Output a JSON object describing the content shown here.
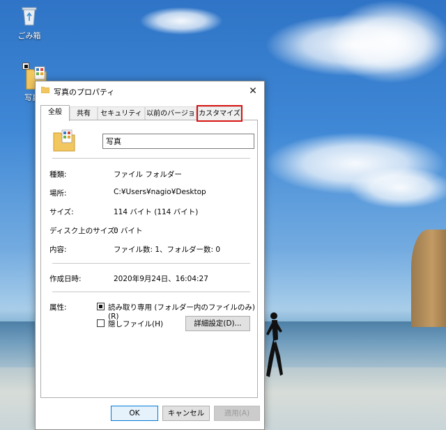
{
  "desktop": {
    "icons": [
      {
        "label": "ごみ箱",
        "icon": "recycle-bin-icon"
      },
      {
        "label": "写真",
        "icon": "folder-icon"
      }
    ]
  },
  "dialog": {
    "title": "写真のプロパティ",
    "close_glyph": "✕",
    "tabs": [
      {
        "label": "全般",
        "active": true
      },
      {
        "label": "共有"
      },
      {
        "label": "セキュリティ"
      },
      {
        "label": "以前のバージョン"
      },
      {
        "label": "カスタマイズ",
        "highlighted": true
      }
    ],
    "name_value": "写真",
    "rows": {
      "type": {
        "label": "種類:",
        "value": "ファイル フォルダー"
      },
      "location": {
        "label": "場所:",
        "value": "C:¥Users¥nagio¥Desktop"
      },
      "size": {
        "label": "サイズ:",
        "value": "114 バイト (114 バイト)"
      },
      "disk_size": {
        "label": "ディスク上のサイズ:",
        "value": "0 バイト"
      },
      "contents": {
        "label": "内容:",
        "value": "ファイル数: 1、フォルダー数: 0"
      },
      "created": {
        "label": "作成日時:",
        "value": "2020年9月24日、16:04:27"
      }
    },
    "attributes": {
      "label": "属性:",
      "readonly_label": "読み取り専用 (フォルダー内のファイルのみ)(R)",
      "hidden_label": "隠しファイル(H)",
      "advanced_button": "詳細設定(D)..."
    },
    "buttons": {
      "ok": "OK",
      "cancel": "キャンセル",
      "apply": "適用(A)"
    },
    "colors": {
      "highlight": "#d81414",
      "accent": "#0078d7"
    }
  }
}
